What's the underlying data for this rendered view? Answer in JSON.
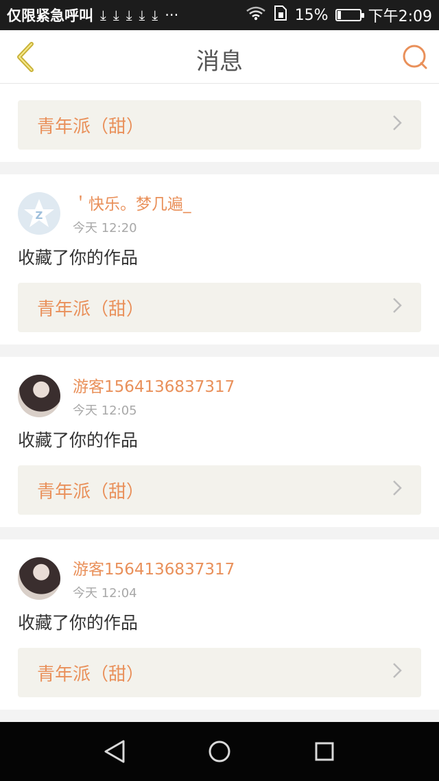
{
  "status_bar": {
    "carrier": "仅限紧急呼叫",
    "downloads": [
      "⤓",
      "⤓",
      "⤓",
      "⤓",
      "⤓"
    ],
    "more": "···",
    "battery_percent_text": "15%",
    "battery_level": 0.15,
    "time": "下午2:09",
    "icons": [
      "wifi-icon",
      "sim-icon",
      "battery-icon"
    ]
  },
  "header": {
    "title": "消息",
    "back_icon": "chevron-left-icon",
    "search_icon": "search-icon"
  },
  "colors": {
    "accent": "#e9905a",
    "back_arrow": "#c9b23a",
    "card_link_bg": "#f3f2ec",
    "page_bg": "#f3f3f3"
  },
  "partial_item": {
    "work_title": "青年派（甜）"
  },
  "notifications": [
    {
      "username": "＇快乐。梦几遍_",
      "time": "今天 12:20",
      "action": "收藏了你的作品",
      "work_title": "青年派（甜）",
      "avatar": "default-star-avatar"
    },
    {
      "username": "游客1564136837317",
      "time": "今天 12:05",
      "action": "收藏了你的作品",
      "work_title": "青年派（甜）",
      "avatar": "photo-avatar"
    },
    {
      "username": "游客1564136837317",
      "time": "今天 12:04",
      "action": "收藏了你的作品",
      "work_title": "青年派（甜）",
      "avatar": "photo-avatar"
    }
  ],
  "nav_bar": {
    "icons": [
      "back-triangle-icon",
      "home-circle-icon",
      "recents-square-icon"
    ]
  }
}
